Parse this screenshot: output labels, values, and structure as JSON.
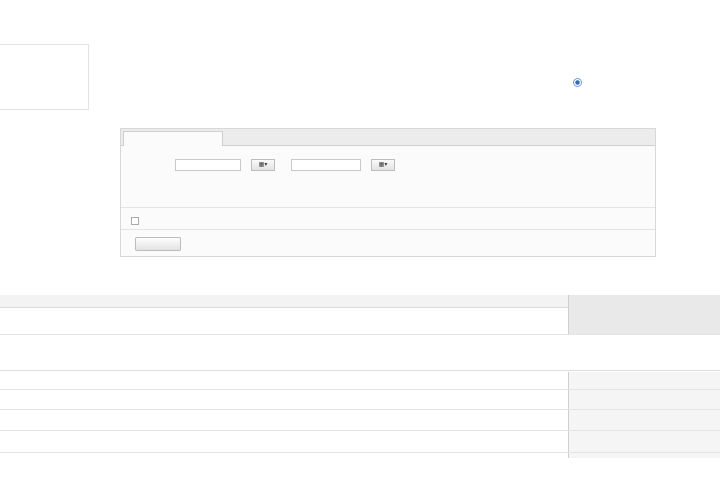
{
  "sidebar": {
    "items": [
      {
        "label": ""
      },
      {
        "label": ""
      },
      {
        "label": ""
      }
    ]
  },
  "header": {
    "title": "",
    "meta": [
      {
        "label": "",
        "value": ""
      },
      {
        "label": "",
        "value": ""
      },
      {
        "label": "",
        "value": "",
        "link": ""
      },
      {
        "label": "",
        "value": ""
      }
    ],
    "autoupdate_label": ""
  },
  "filters": {
    "tabs": [
      {
        "label": ""
      },
      {
        "label": ""
      },
      {
        "label": ""
      },
      {
        "label": ""
      },
      {
        "label": ""
      },
      {
        "label": ""
      }
    ],
    "period_label": "",
    "date_from": "",
    "date_to": "",
    "date_separator": "",
    "quick_ranges": [
      {
        "label": ""
      },
      {
        "label": ""
      },
      {
        "label": ""
      },
      {
        "label": ""
      },
      {
        "label": ""
      },
      {
        "label": ""
      }
    ],
    "extra_settings_link": "",
    "checkbox_label": "",
    "show_button": ""
  },
  "summary_table": {
    "columns": [
      "",
      "",
      "",
      "",
      "",
      "",
      "",
      "",
      "",
      ""
    ],
    "row": [
      "",
      "",
      "",
      "",
      "",
      "",
      "",
      "",
      "",
      ""
    ]
  },
  "detail_section": {
    "title": "",
    "right_link": "",
    "columns": [
      "",
      "",
      "",
      "",
      "",
      "",
      "",
      ""
    ],
    "rows": [
      [
        "",
        "",
        "",
        "",
        "",
        "",
        "",
        "",
        ""
      ],
      [
        "",
        "",
        "",
        "",
        "",
        "",
        "",
        "",
        ""
      ],
      [
        "",
        "",
        "",
        "",
        "",
        "",
        "",
        "",
        ""
      ]
    ]
  },
  "colors": {
    "link": "#2b4fa8",
    "accent_radio": "#3366cc",
    "shade": "#e9e9e9"
  }
}
